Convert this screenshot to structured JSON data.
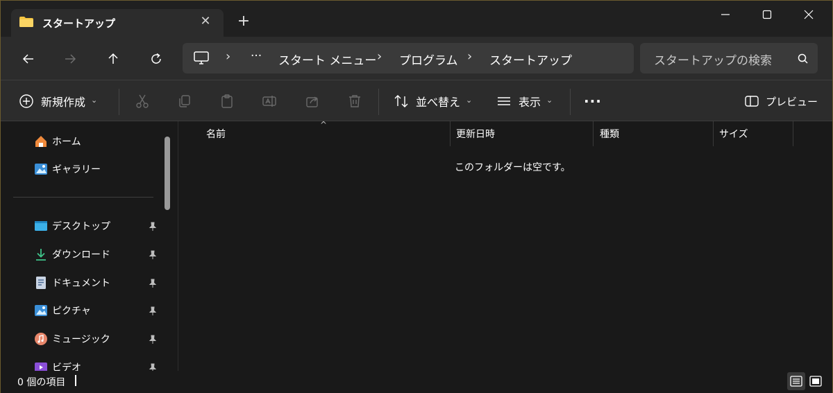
{
  "tab": {
    "title": "スタートアップ",
    "close": "✕",
    "new_tab": "+"
  },
  "address": {
    "overflow": "···",
    "parts": [
      "スタート メニュー",
      "プログラム",
      "スタートアップ"
    ],
    "sep": "›"
  },
  "search": {
    "placeholder": "スタートアップの検索"
  },
  "commands": {
    "new": "新規作成",
    "sort": "並べ替え",
    "view": "表示",
    "more": "···",
    "preview": "プレビュー"
  },
  "sidebar": {
    "items": [
      {
        "label": "ホーム",
        "icon": "home-icon"
      },
      {
        "label": "ギャラリー",
        "icon": "gallery-icon"
      },
      {
        "label": "デスクトップ",
        "icon": "desktop-icon"
      },
      {
        "label": "ダウンロード",
        "icon": "download-icon"
      },
      {
        "label": "ドキュメント",
        "icon": "document-icon"
      },
      {
        "label": "ピクチャ",
        "icon": "pictures-icon"
      },
      {
        "label": "ミュージック",
        "icon": "music-icon"
      },
      {
        "label": "ビデオ",
        "icon": "video-icon"
      }
    ]
  },
  "columns": {
    "name": "名前",
    "modified": "更新日時",
    "type": "種類",
    "size": "サイズ"
  },
  "list": {
    "empty_message": "このフォルダーは空です。"
  },
  "status": {
    "count_text": "0 個の項目"
  },
  "colors": {
    "folder": "#f4c542",
    "accent": "#4cc2ff",
    "window_border": "#6b5a2e"
  }
}
